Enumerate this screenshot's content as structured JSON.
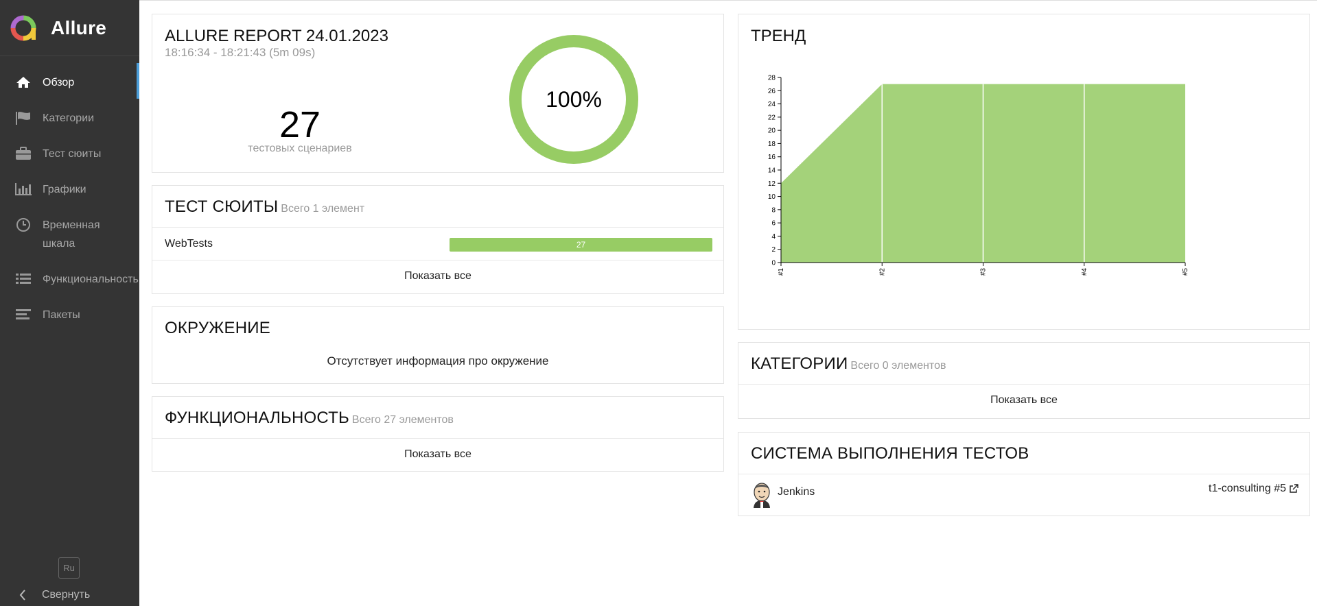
{
  "brand": {
    "name": "Allure"
  },
  "sidebar": {
    "items": [
      {
        "label": "Обзор",
        "icon": "home-icon",
        "active": true
      },
      {
        "label": "Категории",
        "icon": "flag-icon"
      },
      {
        "label": "Тест сюиты",
        "icon": "briefcase-icon"
      },
      {
        "label": "Графики",
        "icon": "bar-chart-icon"
      },
      {
        "label": "Временная шкала",
        "icon": "clock-icon"
      },
      {
        "label": "Функциональность",
        "icon": "list-icon"
      },
      {
        "label": "Пакеты",
        "icon": "align-left-icon"
      }
    ],
    "language": "Ru",
    "collapse_label": "Свернуть"
  },
  "summary": {
    "title": "ALLURE REPORT 24.01.2023",
    "time": "18:16:34 - 18:21:43 (5m 09s)",
    "count": "27",
    "count_label": "тестовых сценариев",
    "percent": "100%",
    "pass_fraction": 1.0
  },
  "suites": {
    "title": "ТЕСТ СЮИТЫ",
    "subtitle": "Всего 1 элемент",
    "rows": [
      {
        "name": "WebTests",
        "count": "27",
        "passed_fraction": 1.0
      }
    ],
    "show_all": "Показать все"
  },
  "environment": {
    "title": "ОКРУЖЕНИЕ",
    "empty_text": "Отсутствует информация про окружение"
  },
  "features": {
    "title": "ФУНКЦИОНАЛЬНОСТЬ",
    "subtitle": "Всего 27 элементов",
    "show_all": "Показать все"
  },
  "trend": {
    "title": "ТРЕНД"
  },
  "chart_data": {
    "type": "area",
    "title": "ТРЕНД",
    "x": [
      "#1",
      "#2",
      "#3",
      "#4",
      "#5"
    ],
    "series": [
      {
        "values": [
          12,
          27,
          27,
          27,
          27
        ],
        "color": "#a4d27a"
      }
    ],
    "ylim": [
      0,
      28
    ],
    "yticks": [
      0,
      2,
      4,
      6,
      8,
      10,
      12,
      14,
      16,
      18,
      20,
      22,
      24,
      26,
      28
    ],
    "grid": false
  },
  "categories": {
    "title": "КАТЕГОРИИ",
    "subtitle": "Всего 0 элементов",
    "show_all": "Показать все"
  },
  "executors": {
    "title": "СИСТЕМА ВЫПОЛНЕНИЯ ТЕСТОВ",
    "name": "Jenkins",
    "build": "t1-consulting #5"
  },
  "colors": {
    "passed": "#97cc64",
    "sidebar": "#343434",
    "active_marker": "#4c9ed9"
  }
}
